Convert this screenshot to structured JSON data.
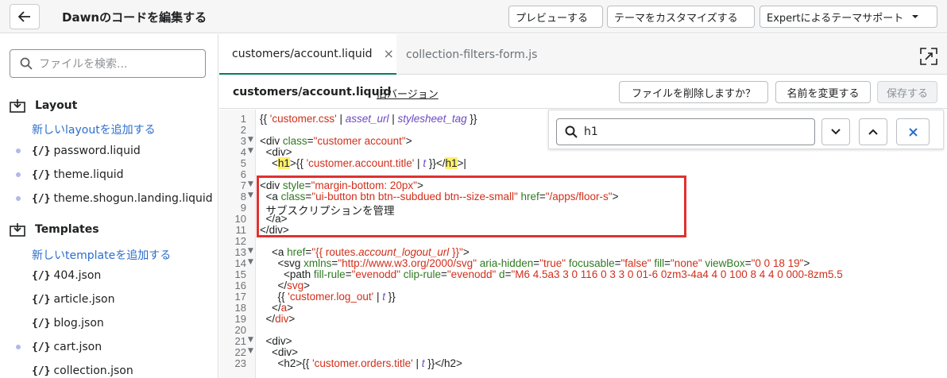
{
  "header": {
    "title": "Dawnのコードを編集する",
    "preview": "プレビューする",
    "customize": "テーマをカスタマイズする",
    "support": "Expertによるテーマサポート"
  },
  "sidebar": {
    "search_placeholder": "ファイルを検索...",
    "layout_title": "Layout",
    "layout_add": "新しいlayoutを追加する",
    "layout_files": [
      "password.liquid",
      "theme.liquid",
      "theme.shogun.landing.liquid"
    ],
    "templates_title": "Templates",
    "templates_add": "新しいtemplateを追加する",
    "template_files": [
      "404.json",
      "article.json",
      "blog.json",
      "cart.json",
      "collection.json"
    ],
    "file_icon": "{/}"
  },
  "tabs": {
    "active": "customers/account.liquid",
    "other": "collection-filters-form.js",
    "close": "×"
  },
  "filebar": {
    "filename": "customers/account.liquid",
    "old_version": "旧バージョン",
    "delete": "ファイルを削除しますか？",
    "rename": "名前を変更する",
    "save": "保存する"
  },
  "find": {
    "query": "h1"
  },
  "editor": {
    "line_numbers": [
      "1",
      "2",
      "3",
      "4",
      "5",
      "6",
      "7",
      "8",
      "9",
      "10",
      "11",
      "12",
      "13",
      "14",
      "15",
      "16",
      "17",
      "18",
      "19",
      "20",
      "21",
      "22",
      "23"
    ]
  },
  "colors": {
    "highlight_box": "#e03131",
    "link": "#2c6ecb",
    "accent": "#008060"
  }
}
